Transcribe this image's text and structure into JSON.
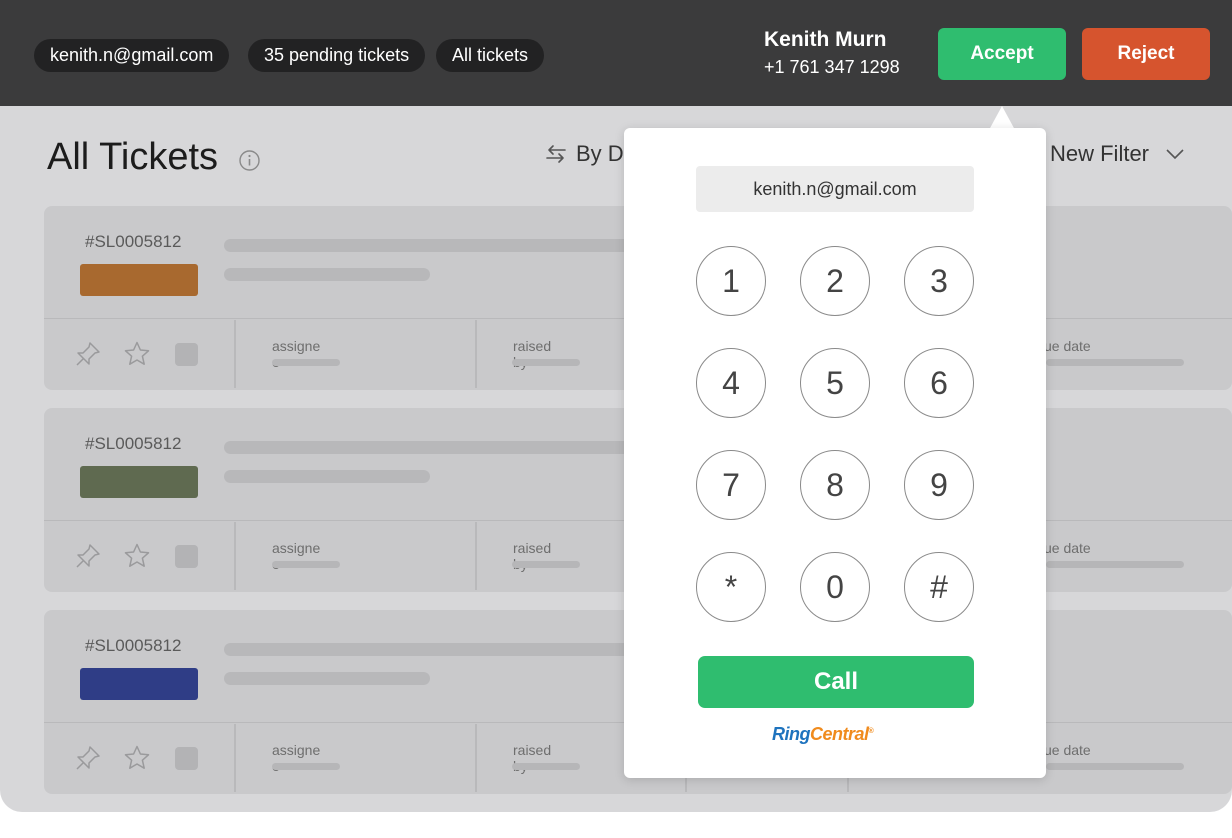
{
  "topbar": {
    "email_pill": "kenith.n@gmail.com",
    "pending_pill": "35 pending tickets",
    "all_pill": "All tickets",
    "caller_name": "Kenith Murn",
    "caller_phone": "+1 761 347 1298",
    "accept_label": "Accept",
    "reject_label": "Reject",
    "accept_color": "#2fbd6f",
    "reject_color": "#d6542e"
  },
  "page": {
    "title": "All Tickets",
    "sort_label": "By D",
    "filter_label": "New Filter"
  },
  "tickets": [
    {
      "id": "#SL0005812",
      "tag_color": "#a8692f",
      "field1": "assigne",
      "field1b": "e",
      "field2": "raised",
      "field2b": "by",
      "field3": "ue date"
    },
    {
      "id": "#SL0005812",
      "tag_color": "#5f6a50",
      "field1": "assigne",
      "field1b": "e",
      "field2": "raised",
      "field2b": "by",
      "field3": "ue date"
    },
    {
      "id": "#SL0005812",
      "tag_color": "#2f3d86",
      "field1": "assigne",
      "field1b": "e",
      "field2": "raised",
      "field2b": "by",
      "field3": "ue date"
    }
  ],
  "dialer": {
    "input_value": "kenith.n@gmail.com",
    "keys": [
      "1",
      "2",
      "3",
      "4",
      "5",
      "6",
      "7",
      "8",
      "9",
      "*",
      "0",
      "#"
    ],
    "call_label": "Call",
    "brand_part1": "Ring",
    "brand_part2": "Central",
    "brand_mark": "®"
  }
}
